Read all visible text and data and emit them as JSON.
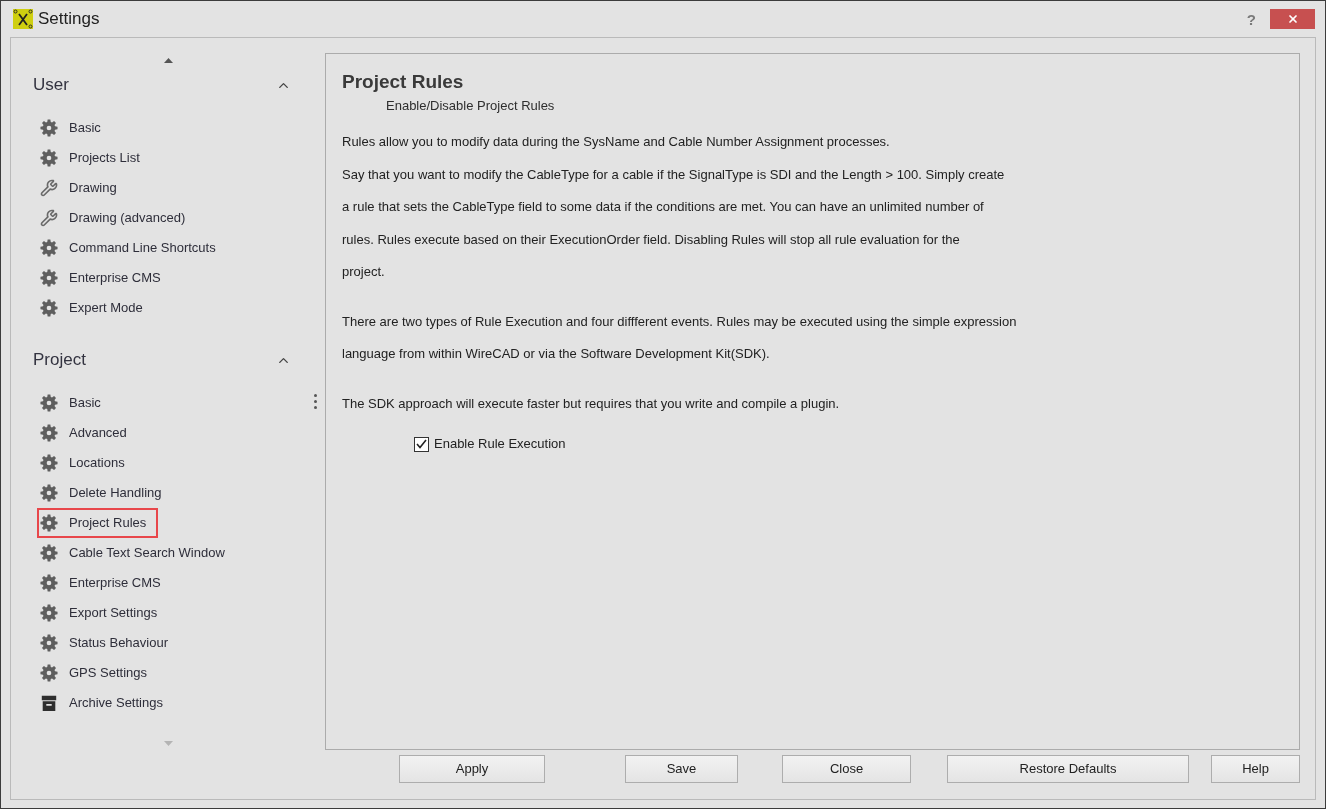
{
  "window": {
    "title": "Settings",
    "help": "?"
  },
  "sidebar": {
    "groups": [
      {
        "title": "User",
        "expanded": true,
        "items": [
          {
            "label": "Basic",
            "kind": "gear",
            "selected": false
          },
          {
            "label": "Projects List",
            "kind": "gear",
            "selected": false
          },
          {
            "label": "Drawing",
            "kind": "wrench",
            "selected": false
          },
          {
            "label": "Drawing (advanced)",
            "kind": "wrench",
            "selected": false
          },
          {
            "label": "Command Line Shortcuts",
            "kind": "gear",
            "selected": false
          },
          {
            "label": "Enterprise CMS",
            "kind": "gear",
            "selected": false
          },
          {
            "label": "Expert Mode",
            "kind": "gear",
            "selected": false
          }
        ]
      },
      {
        "title": "Project",
        "expanded": true,
        "items": [
          {
            "label": "Basic",
            "kind": "gear",
            "selected": false
          },
          {
            "label": "Advanced",
            "kind": "gear",
            "selected": false
          },
          {
            "label": "Locations",
            "kind": "gear",
            "selected": false
          },
          {
            "label": "Delete Handling",
            "kind": "gear",
            "selected": false
          },
          {
            "label": "Project Rules",
            "kind": "gear",
            "selected": true
          },
          {
            "label": "Cable Text Search Window",
            "kind": "gear",
            "selected": false
          },
          {
            "label": "Enterprise CMS",
            "kind": "gear",
            "selected": false
          },
          {
            "label": "Export Settings",
            "kind": "gear",
            "selected": false
          },
          {
            "label": "Status Behaviour",
            "kind": "gear",
            "selected": false
          },
          {
            "label": "GPS Settings",
            "kind": "gear",
            "selected": false
          },
          {
            "label": "Archive Settings",
            "kind": "archive",
            "selected": false
          }
        ]
      }
    ]
  },
  "content": {
    "title": "Project Rules",
    "subtitle": "Enable/Disable Project Rules",
    "paragraphs": [
      "Rules allow you to modify data during the SysName and Cable Number Assignment processes.\nSay that you want to modify the CableType for a cable if the SignalType is SDI and the Length > 100. Simply create\na rule that sets the CableType field to some data if the conditions are met. You can have an unlimited number of\nrules. Rules execute based on their ExecutionOrder field. Disabling Rules will stop all rule evaluation for the\nproject.",
      "There are two types of Rule Execution and four diffferent events. Rules may be executed using the simple expression\nlanguage from within WireCAD or via the Software Development Kit(SDK).",
      "The SDK approach will execute faster but requires that you write and compile a plugin."
    ],
    "checkbox": {
      "label": "Enable Rule Execution",
      "checked": true
    }
  },
  "buttons": [
    "Apply",
    "Save",
    "Close",
    "Restore Defaults",
    "Help"
  ]
}
